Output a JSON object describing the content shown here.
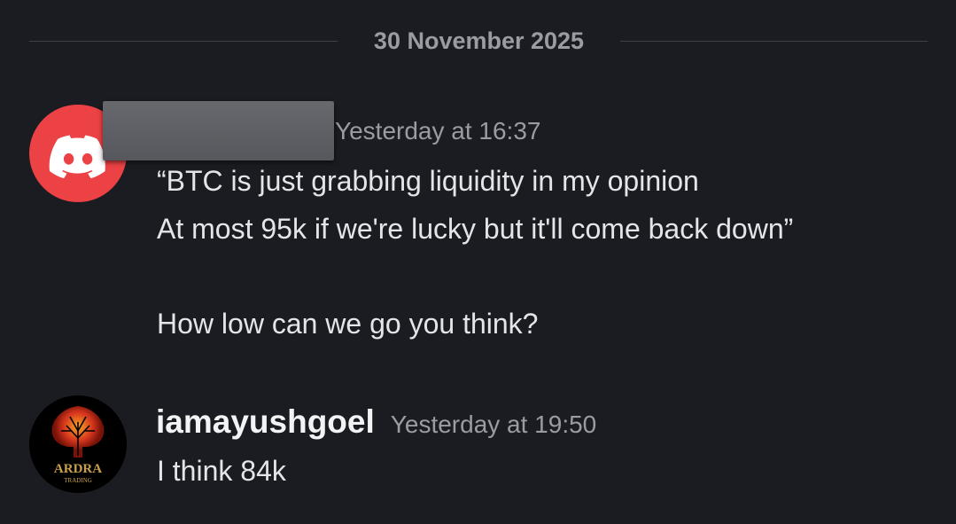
{
  "divider": {
    "date": "30 November 2025"
  },
  "messages": [
    {
      "avatar": "discord-logo-icon",
      "avatar_color": "#ed4245",
      "username": "",
      "username_redacted": true,
      "timestamp": "Yesterday at 16:37",
      "lines": [
        "“BTC is just grabbing liquidity in my opinion",
        "At most 95k if we're lucky but it'll come back down”",
        "How low can we go you think?"
      ]
    },
    {
      "avatar": "ardra-trading-logo",
      "avatar_logo_text": "ARDRA",
      "avatar_logo_subtext": "TRADING",
      "username": "iamayushgoel",
      "timestamp": "Yesterday at 19:50",
      "lines": [
        "I think 84k"
      ]
    }
  ],
  "colors": {
    "background": "#1b1c21",
    "text": "#e3e5e8",
    "muted": "#9a9ca3",
    "discord_red": "#ed4245",
    "logo_gold": "#c9a14a"
  }
}
